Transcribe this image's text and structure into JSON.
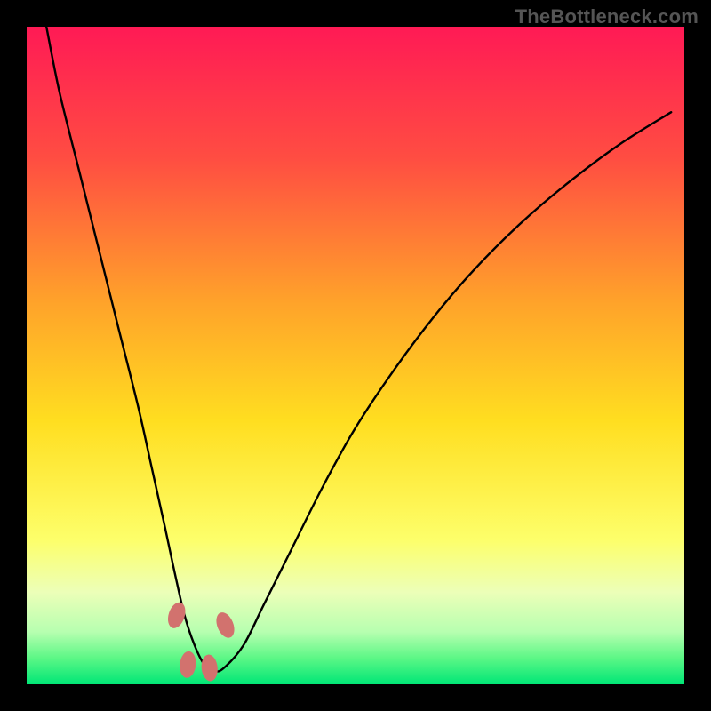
{
  "watermark": "TheBottleneck.com",
  "chart_data": {
    "type": "line",
    "title": "",
    "xlabel": "",
    "ylabel": "",
    "xlim": [
      0,
      100
    ],
    "ylim": [
      0,
      100
    ],
    "series": [
      {
        "name": "bottleneck-curve",
        "x": [
          3,
          5,
          8,
          11,
          14,
          17,
          19,
          21,
          22.5,
          24,
          25.5,
          27,
          28.5,
          30,
          33,
          36,
          40,
          45,
          50,
          56,
          62,
          68,
          75,
          82,
          90,
          98
        ],
        "values": [
          100,
          90,
          78,
          66,
          54,
          42,
          33,
          24,
          17,
          10.5,
          6,
          3,
          2,
          2.5,
          6,
          12,
          20,
          30,
          39,
          48,
          56,
          63,
          70,
          76,
          82,
          87
        ]
      }
    ],
    "markers": [
      {
        "name": "marker-left",
        "x": 22.8,
        "y": 10.5,
        "color": "#d2726e"
      },
      {
        "name": "marker-bottom1",
        "x": 24.5,
        "y": 3.0,
        "color": "#d2726e"
      },
      {
        "name": "marker-bottom2",
        "x": 27.8,
        "y": 2.5,
        "color": "#d2726e"
      },
      {
        "name": "marker-right",
        "x": 30.2,
        "y": 9.0,
        "color": "#d2726e"
      }
    ],
    "gradient_stops": [
      {
        "offset": 0.0,
        "color": "#ff1a55"
      },
      {
        "offset": 0.2,
        "color": "#ff4d42"
      },
      {
        "offset": 0.42,
        "color": "#ffa32a"
      },
      {
        "offset": 0.6,
        "color": "#ffde20"
      },
      {
        "offset": 0.78,
        "color": "#fdff6a"
      },
      {
        "offset": 0.86,
        "color": "#ecffb8"
      },
      {
        "offset": 0.92,
        "color": "#b7ffb0"
      },
      {
        "offset": 0.96,
        "color": "#5cf786"
      },
      {
        "offset": 1.0,
        "color": "#00e676"
      }
    ]
  }
}
